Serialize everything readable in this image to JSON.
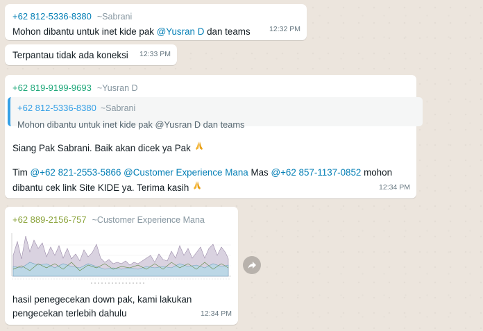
{
  "colors": {
    "bg": "#ece5dd",
    "bubble": "#ffffff",
    "phone_blue": "#027eb5",
    "phone_green": "#1fa87a",
    "phone_olive": "#8aa33a",
    "mention": "#027eb5"
  },
  "messages": [
    {
      "phone": "+62 812-5336-8380",
      "name": "~Sabrani",
      "text_prefix": "Mohon dibantu untuk inet kide pak ",
      "mention": "@Yusran D",
      "text_suffix": " dan teams",
      "time": "12:32 PM"
    },
    {
      "text": "Terpantau tidak ada koneksi",
      "time": "12:33 PM"
    },
    {
      "phone": "+62 819-9199-9693",
      "name": "~Yusran D",
      "quote": {
        "phone": "+62 812-5336-8380",
        "name": "~Sabrani",
        "text": "Mohon dibantu untuk inet kide pak @Yusran D dan teams"
      },
      "line1": "Siang Pak Sabrani. Baik akan dicek ya Pak",
      "line2_prefix": "Tim ",
      "mention1": "@+62 821-2553-5866",
      "mention2": "@Customer Experience Mana",
      "line2_mid": " Mas ",
      "mention3": "@+62 857-1137-0852",
      "line2_suffix": " mohon dibantu cek link Site KIDE ya. Terima kasih",
      "time": "12:34 PM"
    },
    {
      "phone": "+62 889-2156-757",
      "name": "~Customer Experience Mana",
      "caption": "hasil penegecekan down pak, kami lakukan pengecekan terlebih dahulu",
      "time": "12:34 PM"
    }
  ],
  "icons": {
    "praying": "praying-hands-icon",
    "forward": "forward-arrow-icon"
  }
}
